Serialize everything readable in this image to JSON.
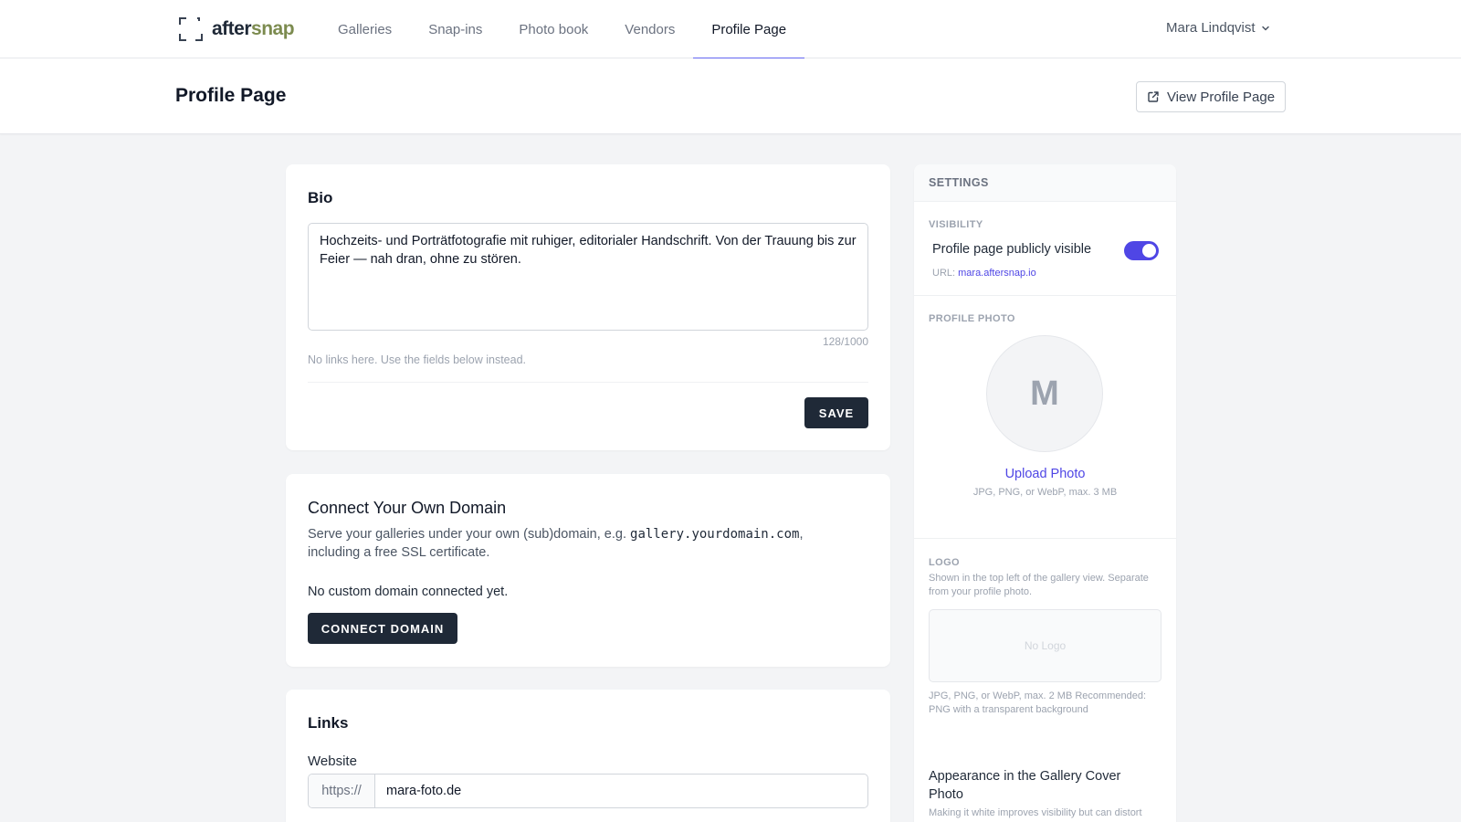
{
  "brand": {
    "name_part1": "after",
    "name_part2": "snap"
  },
  "nav": {
    "items": [
      {
        "label": "Galleries"
      },
      {
        "label": "Snap-ins"
      },
      {
        "label": "Photo book"
      },
      {
        "label": "Vendors"
      },
      {
        "label": "Profile Page",
        "active": true
      }
    ],
    "user_name": "Mara Lindqvist"
  },
  "header": {
    "title": "Profile Page",
    "view_button": "View Profile Page"
  },
  "bio": {
    "title": "Bio",
    "text": "Hochzeits- und Porträtfotografie mit ruhiger, editorialer Handschrift. Von der Trauung bis zur Feier — nah dran, ohne zu stören.",
    "char_count": "128/1000",
    "hint": "No links here. Use the fields below instead.",
    "save_label": "SAVE"
  },
  "domain": {
    "title": "Connect Your Own Domain",
    "desc_before": "Serve your galleries under your own (sub)domain, e.g. ",
    "desc_code": "gallery.yourdomain.com",
    "desc_after": ", including a free SSL certificate.",
    "status": "No custom domain connected yet.",
    "connect_label": "CONNECT DOMAIN"
  },
  "links": {
    "title": "Links",
    "website_label": "Website",
    "website_prefix": "https://",
    "website_value": "mara-foto.de"
  },
  "settings": {
    "title": "SETTINGS",
    "visibility": {
      "label": "VISIBILITY",
      "toggle_text": "Profile page publicly visible",
      "enabled": true,
      "url_prefix": "URL:",
      "url": "mara.aftersnap.io"
    },
    "profile_photo": {
      "label": "PROFILE PHOTO",
      "initial": "M",
      "upload_label": "Upload Photo",
      "hint": "JPG, PNG, or WebP, max. 3 MB"
    },
    "logo": {
      "label": "LOGO",
      "desc": "Shown in the top left of the gallery view. Separate from your profile photo.",
      "placeholder": "No Logo",
      "hint": "JPG, PNG, or WebP, max. 2 MB Recommended: PNG with a transparent background"
    },
    "appearance": {
      "title": "Appearance in the Gallery Cover Photo",
      "desc": "Making it white improves visibility but can distort"
    }
  },
  "colors": {
    "accent": "#4f46e5",
    "brand_green": "#7c8b4f",
    "dark_button": "#1f2937"
  },
  "icons": {
    "logo": "viewfinder-corners-icon",
    "user_menu": "chevron-down-icon",
    "view_profile": "external-link-icon"
  }
}
